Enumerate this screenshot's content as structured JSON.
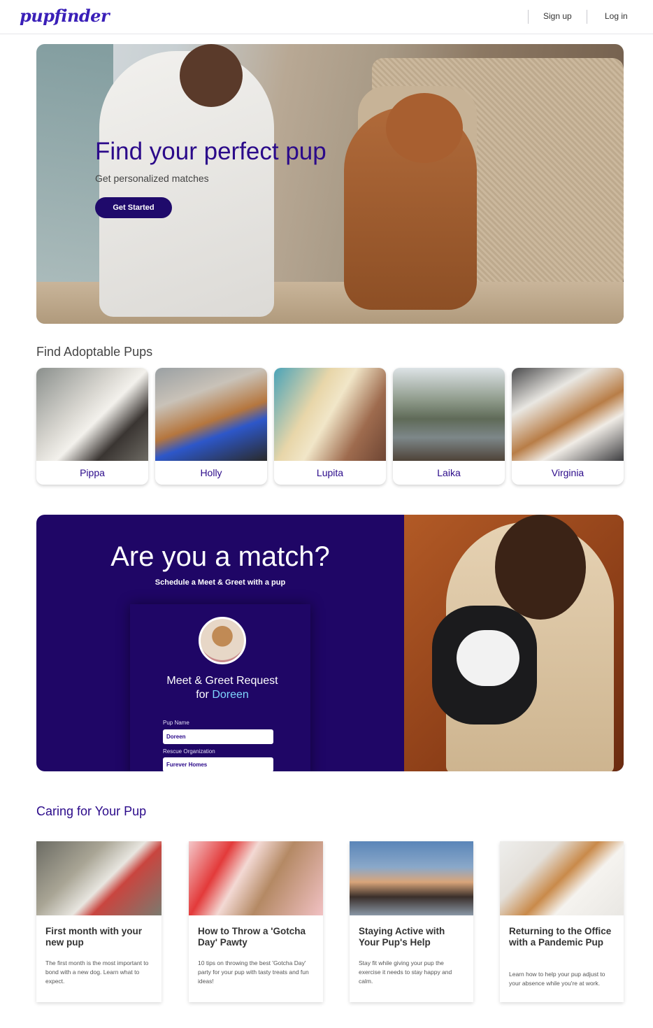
{
  "header": {
    "logo": "pupfinder",
    "signup_label": "Sign up",
    "login_label": "Log in"
  },
  "hero": {
    "title": "Find your perfect pup",
    "subtitle": "Get personalized matches",
    "button_label": "Get Started"
  },
  "adoptable": {
    "title": "Find Adoptable Pups",
    "pups": [
      {
        "name": "Pippa"
      },
      {
        "name": "Holly"
      },
      {
        "name": "Lupita"
      },
      {
        "name": "Laika"
      },
      {
        "name": "Virginia"
      }
    ]
  },
  "match": {
    "title": "Are you a match?",
    "subtitle": "Schedule a Meet & Greet with a pup",
    "form": {
      "heading_line1": "Meet & Greet Request",
      "heading_for": "for",
      "heading_name": "Doreen",
      "pup_name_label": "Pup Name",
      "pup_name_value": "Doreen",
      "rescue_label": "Rescue Organization",
      "rescue_value": "Furever Homes"
    }
  },
  "caring": {
    "title": "Caring for Your Pup",
    "articles": [
      {
        "title": "First month with your new pup",
        "text": "The first month is the most important to bond with a new dog. Learn what to expect."
      },
      {
        "title": "How to Throw a 'Gotcha Day' Pawty",
        "text": "10 tips on throwing the best 'Gotcha Day' party for your pup with tasty treats and fun ideas!"
      },
      {
        "title": "Staying Active with Your Pup's Help",
        "text": "Stay fit while giving your pup the exercise it needs to stay happy and calm."
      },
      {
        "title": "Returning to the Office with a Pandemic Pup",
        "text": "Learn how to help your pup adjust to your absence while you're at work."
      }
    ]
  },
  "colors": {
    "brand": "#2b0a8a",
    "button": "#1f0a6b",
    "match_bg": "#1f0666",
    "highlight": "#7fd6ff"
  }
}
